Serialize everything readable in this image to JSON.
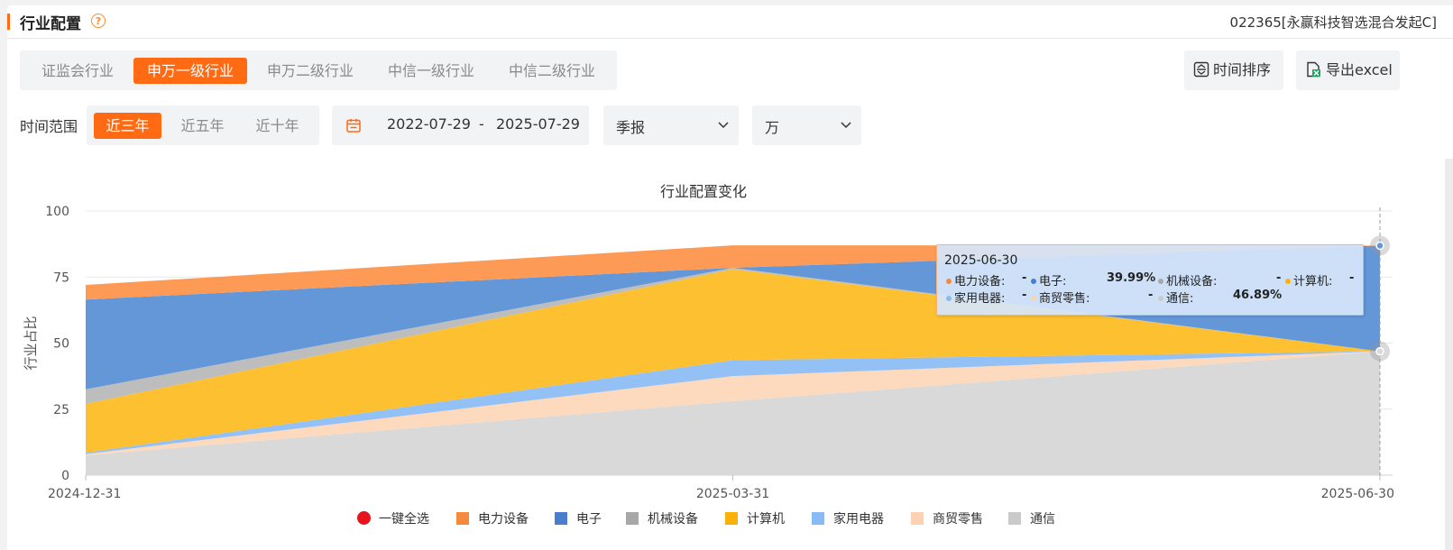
{
  "header": {
    "title": "行业配置",
    "help_icon": "?",
    "fund": "022365[永赢科技智选混合发起C]"
  },
  "industry_tabs": [
    {
      "label": "证监会行业",
      "active": false
    },
    {
      "label": "申万一级行业",
      "active": true
    },
    {
      "label": "申万二级行业",
      "active": false
    },
    {
      "label": "中信一级行业",
      "active": false
    },
    {
      "label": "中信二级行业",
      "active": false
    }
  ],
  "toolbar": {
    "sort_label": "时间排序",
    "export_label": "导出excel"
  },
  "filters": {
    "range_label": "时间范围",
    "ranges": [
      {
        "label": "近三年",
        "active": true
      },
      {
        "label": "近五年",
        "active": false
      },
      {
        "label": "近十年",
        "active": false
      }
    ],
    "date_start": "2022-07-29",
    "date_sep": "-",
    "date_end": "2025-07-29",
    "period_select": "季报",
    "unit_select": "万"
  },
  "chart_data": {
    "type": "area",
    "stacked": true,
    "title": "行业配置变化",
    "ylabel": "行业占比",
    "ylim": [
      0,
      100
    ],
    "yticks": [
      "0",
      "25",
      "50",
      "75",
      "100"
    ],
    "x": [
      "2024-12-31",
      "2025-03-31",
      "2025-06-30"
    ],
    "series": [
      {
        "name": "通信",
        "color": "#d9d9d9",
        "values": [
          7.5,
          28.0,
          46.89
        ]
      },
      {
        "name": "商贸零售",
        "color": "#fdd9bd",
        "values": [
          0.5,
          9.5,
          0
        ]
      },
      {
        "name": "家用电器",
        "color": "#93c1f5",
        "values": [
          0.5,
          6.0,
          0
        ]
      },
      {
        "name": "计算机",
        "color": "#fdc030",
        "values": [
          18.5,
          34.5,
          0
        ]
      },
      {
        "name": "机械设备",
        "color": "#bdbdbd",
        "values": [
          5.5,
          0.5,
          0
        ]
      },
      {
        "name": "电子",
        "color": "#6397d8",
        "values": [
          34.0,
          0,
          39.99
        ]
      },
      {
        "name": "电力设备",
        "color": "#fd9a55",
        "values": [
          5.5,
          8.5,
          0
        ]
      }
    ],
    "legend": [
      {
        "name": "一键全选",
        "color": "#e8141b",
        "shape": "circle"
      },
      {
        "name": "电力设备",
        "color": "#f58a3e",
        "shape": "square"
      },
      {
        "name": "电子",
        "color": "#4a7ecd",
        "shape": "square"
      },
      {
        "name": "机械设备",
        "color": "#a8a8a8",
        "shape": "square"
      },
      {
        "name": "计算机",
        "color": "#fbb10a",
        "shape": "square"
      },
      {
        "name": "家用电器",
        "color": "#88baf5",
        "shape": "square"
      },
      {
        "name": "商贸零售",
        "color": "#fcd2b3",
        "shape": "square"
      },
      {
        "name": "通信",
        "color": "#cacaca",
        "shape": "square"
      }
    ],
    "legend_position": "bottom",
    "grid": true
  },
  "tooltip": {
    "date": "2025-06-30",
    "items": [
      {
        "name": "电力设备:",
        "value": "-",
        "color": "#f58a3e"
      },
      {
        "name": "电子:",
        "value": "39.99%",
        "color": "#4a7ecd"
      },
      {
        "name": "机械设备:",
        "value": "-",
        "color": "#a8a8a8"
      },
      {
        "name": "计算机:",
        "value": "-",
        "color": "#fbb10a"
      },
      {
        "name": "家用电器:",
        "value": "-",
        "color": "#88baf5"
      },
      {
        "name": "商贸零售:",
        "value": "-",
        "color": "#fcd2b3"
      },
      {
        "name": "通信:",
        "value": "46.89%",
        "color": "#cacaca"
      }
    ]
  }
}
